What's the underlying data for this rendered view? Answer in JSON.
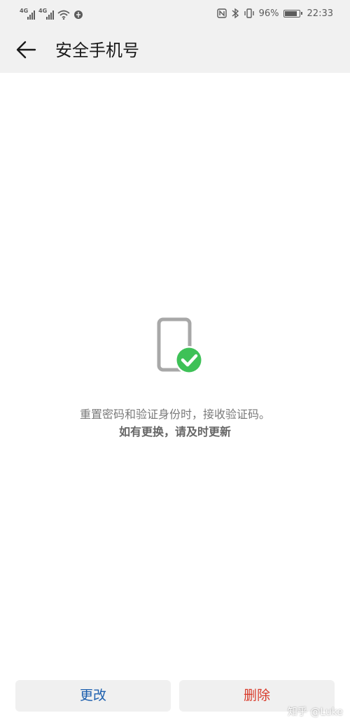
{
  "status_bar": {
    "network_left_1": "4G",
    "network_left_2": "4G",
    "battery_text": "96%",
    "battery_level": 0.96,
    "time": "22:33",
    "icons": [
      "signal-icon",
      "signal-icon",
      "wifi-icon",
      "location-icon",
      "nfc-icon",
      "bluetooth-icon",
      "vibrate-icon",
      "battery-icon"
    ]
  },
  "app_bar": {
    "back_icon": "arrow-left-icon",
    "title": "安全手机号"
  },
  "main": {
    "icon": "phone-verified-icon",
    "description": "重置密码和验证身份时，接收验证码。",
    "notice": "如有更换，请及时更新"
  },
  "actions": {
    "change_label": "更改",
    "delete_label": "删除"
  },
  "watermark": {
    "text": "知乎 @Luke"
  },
  "colors": {
    "accent_blue": "#1b5eae",
    "danger_red": "#d83a2a",
    "success_green": "#3ec157",
    "app_bar_bg": "#f1f1f1"
  }
}
